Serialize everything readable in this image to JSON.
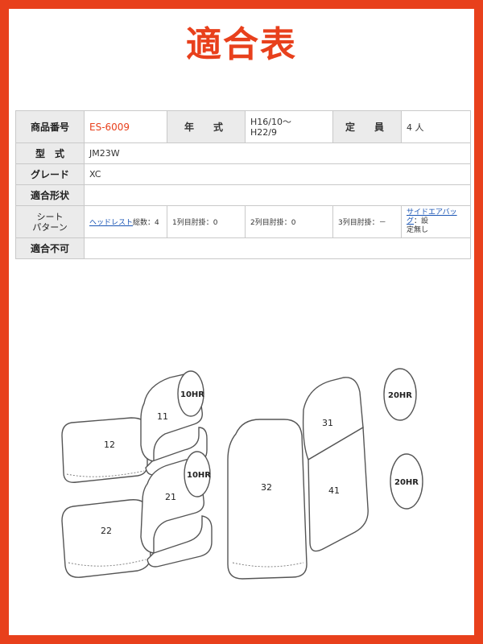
{
  "title": "適合表",
  "table": {
    "product_no_label": "商品番号",
    "product_no": "ES-6009",
    "year_label": "年　式",
    "year_line1": "H16/10〜",
    "year_line2": "H22/9",
    "capacity_label": "定　員",
    "capacity": "4 人",
    "model_label": "型　式",
    "model": "JM23W",
    "grade_label": "グレード",
    "grade": "XC",
    "fit_shape_label": "適合形状",
    "fit_shape": "",
    "seat_pattern_label_1": "シート",
    "seat_pattern_label_2": "パターン",
    "headrest_link": "ヘッドレスト",
    "headrest_rest": "総数：4",
    "row1": "1列目肘掛：0",
    "row2": "2列目肘掛：0",
    "row3": "3列目肘掛：－",
    "airbag_link": "サイドエアバッグ",
    "airbag_rest_1": "：設",
    "airbag_rest_2": "定無し",
    "incompatible_label": "適合不可",
    "incompatible": ""
  },
  "diagram": {
    "parts": [
      "11",
      "12",
      "21",
      "22",
      "31",
      "32",
      "41"
    ],
    "headrests": [
      "10HR",
      "10HR",
      "20HR",
      "20HR"
    ]
  },
  "colors": {
    "border": "#e8401c",
    "title": "#e8401c",
    "label_bg": "#ebebeb",
    "link": "#1a55b5"
  }
}
